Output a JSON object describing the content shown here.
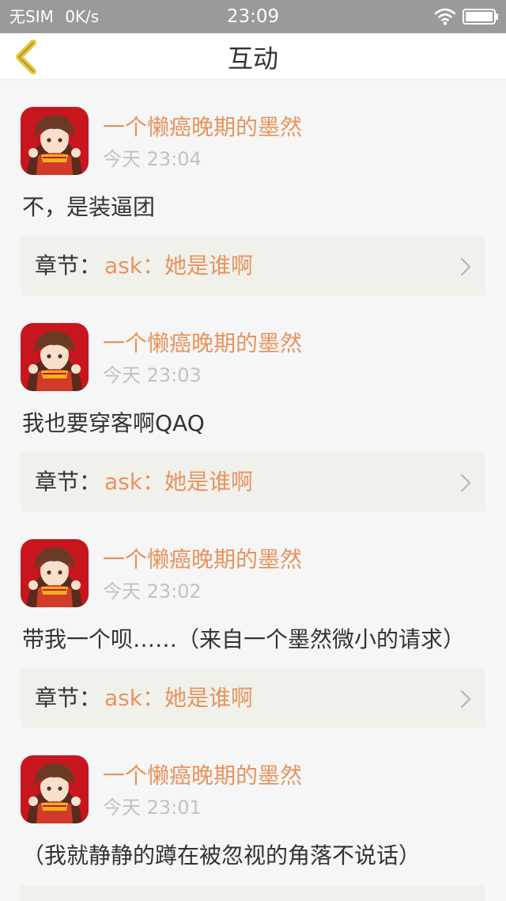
{
  "status_bar": {
    "carrier": "无SIM",
    "speed": "0K/s",
    "time": "23:09",
    "wifi_icon": "wifi-icon",
    "battery_icon": "battery-icon"
  },
  "header": {
    "title": "互动",
    "back_icon": "chevron-left-icon"
  },
  "colors": {
    "accent": "#e8935e",
    "back_arrow": "#e8c83a",
    "status_bar_bg": "#9a9a9a",
    "card_bg": "#f1f1ec"
  },
  "comments": [
    {
      "username": "一个懒癌晚期的墨然",
      "time": "今天 23:04",
      "text": "不，是装逼团",
      "chapter_prefix": "章节：",
      "chapter_name": "ask：她是谁啊"
    },
    {
      "username": "一个懒癌晚期的墨然",
      "time": "今天 23:03",
      "text": "我也要穿客啊QAQ",
      "chapter_prefix": "章节：",
      "chapter_name": "ask：她是谁啊"
    },
    {
      "username": "一个懒癌晚期的墨然",
      "time": "今天 23:02",
      "text": "带我一个呗……（来自一个墨然微小的请求）",
      "chapter_prefix": "章节：",
      "chapter_name": "ask：她是谁啊"
    },
    {
      "username": "一个懒癌晚期的墨然",
      "time": "今天 23:01",
      "text": "（我就静静的蹲在被忽视的角落不说话）"
    }
  ]
}
